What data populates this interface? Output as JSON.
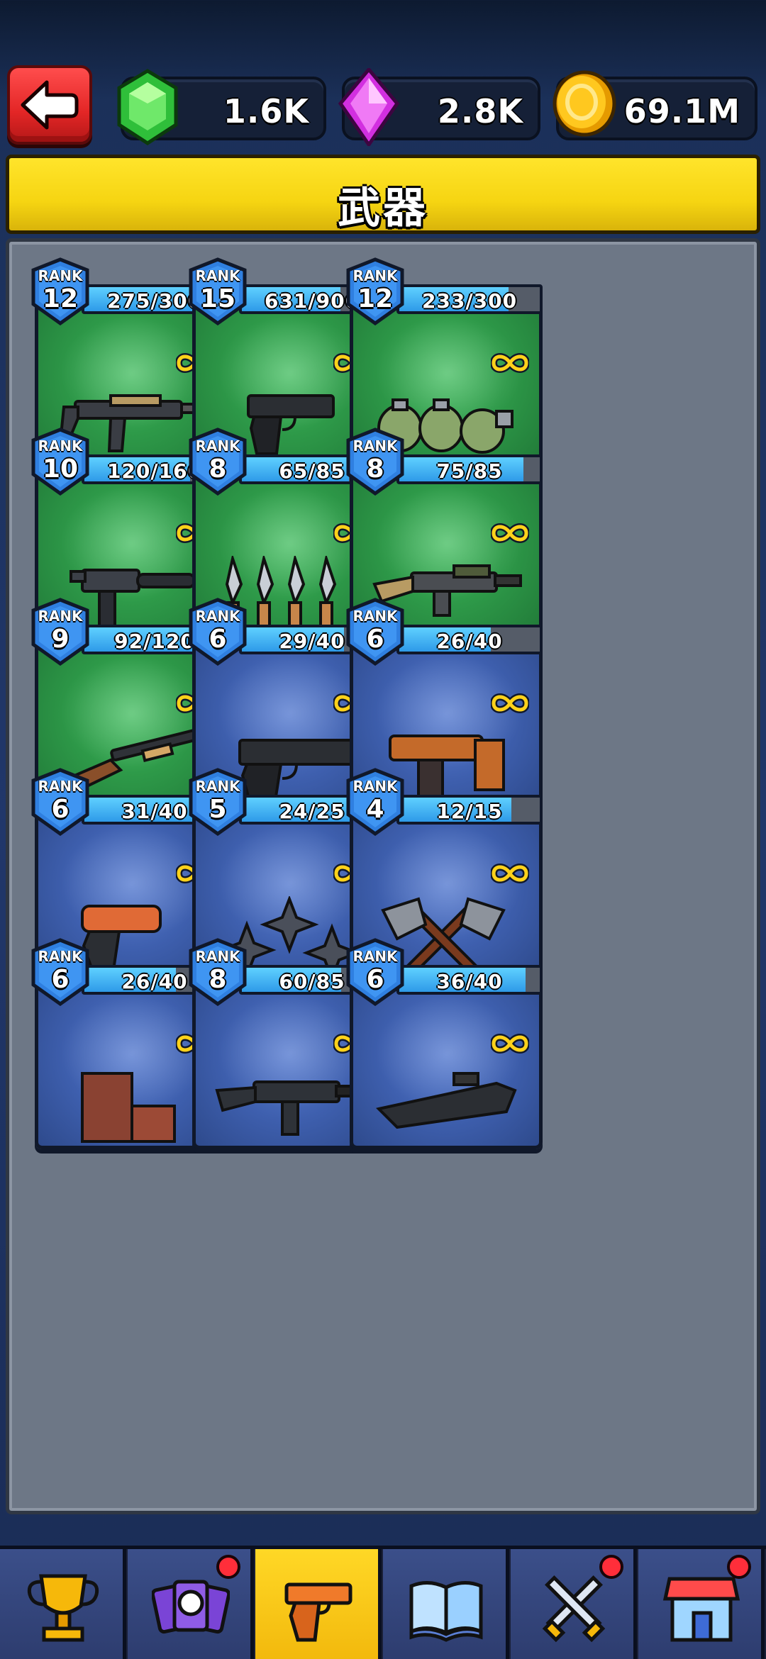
{
  "header": {
    "back_label": "",
    "currencies": [
      {
        "name": "green-gem",
        "value": "1.6K",
        "color": "#3ccf3a"
      },
      {
        "name": "purple-crystal",
        "value": "2.8K",
        "color": "#e040e8"
      },
      {
        "name": "gold-coin",
        "value": "69.1M",
        "color": "#f7b800"
      }
    ]
  },
  "title": "武器",
  "weapons": [
    {
      "name": "能量手枪",
      "rank_label": "RANK",
      "rank": "12",
      "progress": "275/300",
      "fraction": 0.917,
      "bg": "green",
      "icon": "energy-pistol-icon"
    },
    {
      "name": "Glock",
      "rank_label": "RANK",
      "rank": "15",
      "progress": "631/900",
      "fraction": 0.701,
      "bg": "green",
      "icon": "glock-icon"
    },
    {
      "name": "手榴弹",
      "rank_label": "RANK",
      "rank": "12",
      "progress": "233/300",
      "fraction": 0.777,
      "bg": "green",
      "icon": "grenade-icon"
    },
    {
      "name": "M10",
      "rank_label": "RANK",
      "rank": "10",
      "progress": "120/160",
      "fraction": 0.75,
      "bg": "green",
      "icon": "m10-icon"
    },
    {
      "name": "飞刀",
      "rank_label": "RANK",
      "rank": "8",
      "progress": "65/85",
      "fraction": 0.765,
      "bg": "green",
      "icon": "throwing-knife-icon"
    },
    {
      "name": "能量步枪",
      "rank_label": "RANK",
      "rank": "8",
      "progress": "75/85",
      "fraction": 0.882,
      "bg": "green",
      "icon": "energy-rifle-icon"
    },
    {
      "name": "霰弹枪",
      "rank_label": "RANK",
      "rank": "9",
      "progress": "92/120",
      "fraction": 0.767,
      "bg": "green",
      "icon": "shotgun-icon"
    },
    {
      "name": "沙漠之鹰",
      "rank_label": "RANK",
      "rank": "6",
      "progress": "29/40",
      "fraction": 0.725,
      "bg": "blue",
      "icon": "desert-eagle-icon"
    },
    {
      "name": "射钉枪",
      "rank_label": "RANK",
      "rank": "6",
      "progress": "26/40",
      "fraction": 0.65,
      "bg": "blue",
      "icon": "nail-gun-icon"
    },
    {
      "name": "爆裂枪",
      "rank_label": "RANK",
      "rank": "6",
      "progress": "31/40",
      "fraction": 0.775,
      "bg": "blue",
      "icon": "flare-gun-icon"
    },
    {
      "name": "手里剑",
      "rank_label": "RANK",
      "rank": "5",
      "progress": "24/25",
      "fraction": 0.96,
      "bg": "blue",
      "icon": "shuriken-icon"
    },
    {
      "name": "飞斧",
      "rank_label": "RANK",
      "rank": "4",
      "progress": "12/15",
      "fraction": 0.8,
      "bg": "blue",
      "icon": "throwing-axe-icon"
    },
    {
      "name": "砖块",
      "rank_label": "RANK",
      "rank": "6",
      "progress": "26/40",
      "fraction": 0.65,
      "bg": "blue",
      "icon": "brick-icon"
    },
    {
      "name": "G36",
      "rank_label": "RANK",
      "rank": "8",
      "progress": "60/85",
      "fraction": 0.706,
      "bg": "blue",
      "icon": "g36-icon"
    },
    {
      "name": "P90",
      "rank_label": "RANK",
      "rank": "6",
      "progress": "36/40",
      "fraction": 0.9,
      "bg": "blue",
      "icon": "p90-icon"
    }
  ],
  "nav": [
    {
      "icon": "trophy-icon",
      "active": false,
      "badge": false
    },
    {
      "icon": "character-cards-icon",
      "active": false,
      "badge": true
    },
    {
      "icon": "pistol-icon",
      "active": true,
      "badge": false
    },
    {
      "icon": "book-icon",
      "active": false,
      "badge": false
    },
    {
      "icon": "crossed-swords-icon",
      "active": false,
      "badge": true
    },
    {
      "icon": "shop-icon",
      "active": false,
      "badge": true
    }
  ]
}
